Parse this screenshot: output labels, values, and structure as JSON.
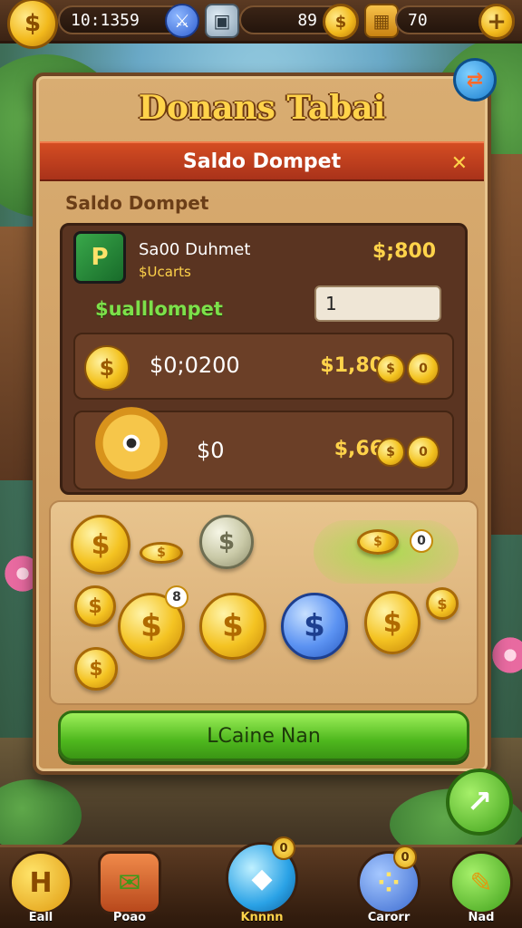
{
  "topbar": {
    "coins": "10:1359",
    "gems": "89",
    "chests": "70"
  },
  "panel": {
    "title": "Donans Tabai",
    "header": "Saldo Dompet",
    "section_label": "Saldo Dompet",
    "account": {
      "name": "Sa00 Duhmet",
      "sub": "$Ucarts",
      "amount": "$;800"
    },
    "wallet_label": "$ualllompet",
    "quantity_value": "1",
    "rows": [
      {
        "text": "$0;0200",
        "value": "$1,80"
      },
      {
        "text": "$0",
        "value": "$,66"
      }
    ],
    "tray_badges": [
      "8",
      "0"
    ],
    "confirm_label": "LCaine Nan"
  },
  "nav": [
    {
      "label": "Eall",
      "icon": "h-icon"
    },
    {
      "label": "Poao",
      "icon": "envelope-plant-icon"
    },
    {
      "label": "Knnnn",
      "icon": "crystal-icon",
      "badge": "0"
    },
    {
      "label": "Carorr",
      "icon": "dots-icon",
      "badge": "0"
    },
    {
      "label": "Nad",
      "icon": "wrench-icon"
    }
  ],
  "colors": {
    "accent": "#ffd34a",
    "header_red": "#c53f1e",
    "confirm_green": "#4fb81e",
    "panel_wood": "#c89457"
  }
}
